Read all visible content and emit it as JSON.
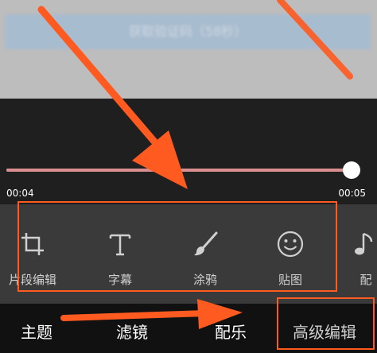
{
  "preview": {
    "button_label": "获取验证码（58秒）"
  },
  "timeline": {
    "start_time": "00:04",
    "end_time": "00:05",
    "progress": 1.0
  },
  "tools": [
    {
      "label": "片段编辑",
      "icon": "crop-icon"
    },
    {
      "label": "字幕",
      "icon": "text-t-icon"
    },
    {
      "label": "涂鸦",
      "icon": "brush-icon"
    },
    {
      "label": "贴图",
      "icon": "smiley-icon"
    },
    {
      "label": "配",
      "icon": "music-note-icon"
    }
  ],
  "tabs": [
    {
      "label": "主题"
    },
    {
      "label": "滤镜"
    },
    {
      "label": "配乐"
    },
    {
      "label": "高级编辑"
    }
  ],
  "colors": {
    "annotation": "#ff5a1f",
    "track": "#d98f8f",
    "tools_bg": "#3a3a3a",
    "tabs_bg": "#111111"
  }
}
